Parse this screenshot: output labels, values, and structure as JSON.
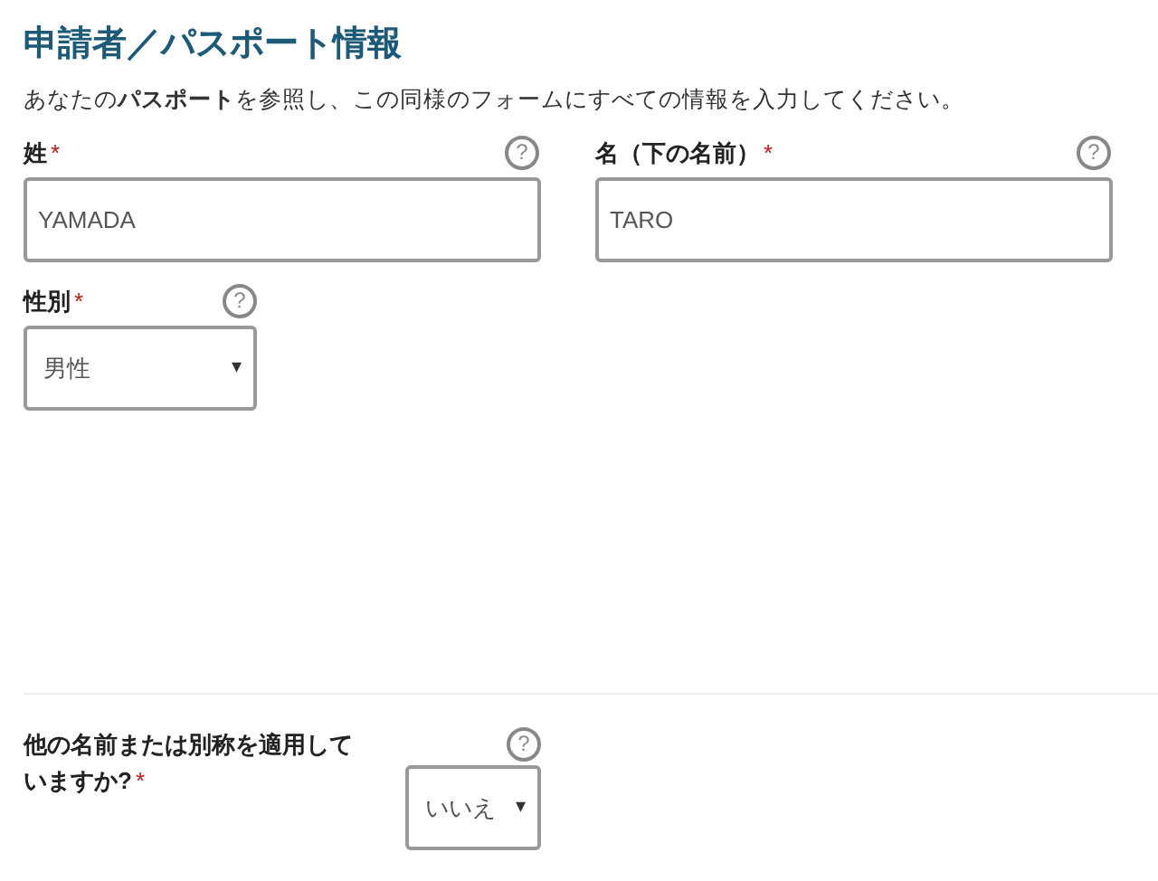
{
  "heading": "申請者／パスポート情報",
  "description": "あなたの**パスポート**を参照し、この同様のフォームにすべての情報を入力してください。",
  "name_fields": [
    {
      "kind": "text",
      "label": "姓",
      "required_mark": "*",
      "help": "?",
      "value": "YAMADA"
    },
    {
      "kind": "text",
      "label": "名（下の名前）",
      "required_mark": "*",
      "help": "?",
      "value": "TARO"
    }
  ],
  "gender_field": {
    "kind": "select",
    "label": "性別",
    "required_mark": "*",
    "help": "?",
    "value": "男性",
    "caret": "▾"
  },
  "alias_field": {
    "kind": "select",
    "label": "他の名前または別称を適用していますか?",
    "required_mark": "*",
    "help": "?",
    "value": "いいえ",
    "caret": "▾"
  }
}
